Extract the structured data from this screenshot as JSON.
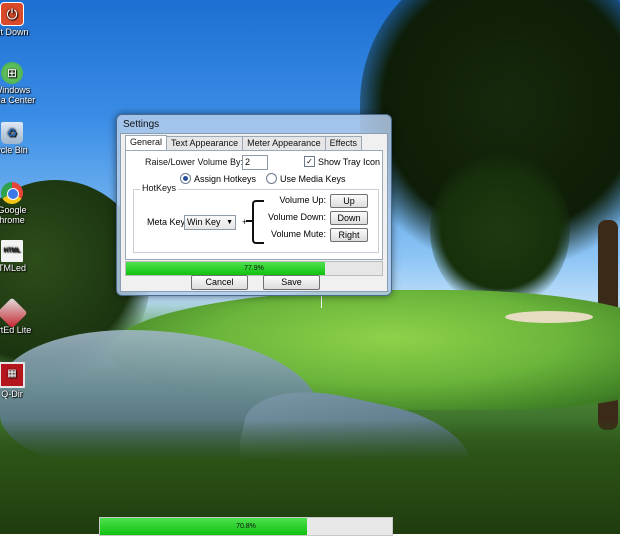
{
  "desktop": {
    "icons": [
      {
        "label": "ut Down",
        "icon": "power-icon",
        "color": "#d94a2a"
      },
      {
        "label": "Windows\nedia Center",
        "icon": "windows-media-center-icon",
        "color": "#3aa547"
      },
      {
        "label": "ycle Bin",
        "icon": "recycle-bin-icon",
        "color": "#bfd3e6"
      },
      {
        "label": "Google\nhrome",
        "icon": "chrome-icon",
        "color": "#e8433a"
      },
      {
        "label": "TMLed",
        "icon": "html-file-icon",
        "color": "#f3f3f3"
      },
      {
        "label": "artEd Lite",
        "icon": "smarted-icon",
        "color": "#c3202a"
      },
      {
        "label": "Q-Dir",
        "icon": "q-dir-icon",
        "color": "#b5161d"
      }
    ]
  },
  "window": {
    "title": "Settings",
    "tabs": [
      {
        "label": "General",
        "active": true
      },
      {
        "label": "Text Appearance",
        "active": false
      },
      {
        "label": "Meter Appearance",
        "active": false
      },
      {
        "label": "Effects",
        "active": false
      }
    ],
    "general": {
      "raise_label": "Raise/Lower Volume By:",
      "raise_value": "2",
      "show_tray_label": "Show Tray Icon",
      "show_tray_checked": true,
      "assign_hotkeys_label": "Assign Hotkeys",
      "assign_hotkeys_selected": true,
      "use_media_keys_label": "Use Media Keys",
      "use_media_keys_selected": false,
      "hotkeys_group": "HotKeys",
      "meta_key_label": "Meta Key:",
      "meta_key_value": "Win Key",
      "plus": "+",
      "volume_up_label": "Volume Up:",
      "volume_up_key": "Up",
      "volume_down_label": "Volume Down:",
      "volume_down_key": "Down",
      "volume_mute_label": "Volume Mute:",
      "volume_mute_key": "Right"
    },
    "progress": {
      "text": "77.9%",
      "value": 0.779
    },
    "cancel_label": "Cancel",
    "save_label": "Save"
  },
  "overlay_meter": {
    "text": "70.8%",
    "value": 0.708
  }
}
